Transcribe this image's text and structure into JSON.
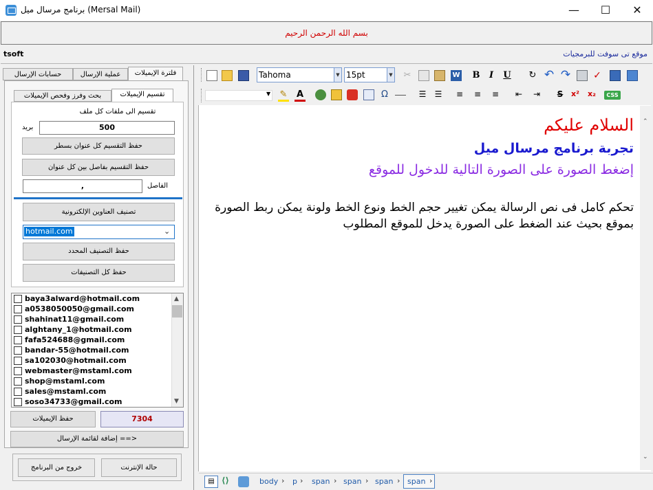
{
  "window": {
    "title": "برنامج مرسال ميل (Mersal Mail)",
    "minimize": "—",
    "maximize": "☐",
    "close": "✕"
  },
  "header": {
    "bismillah": "بسم الله الرحمن الرحيم",
    "brand": "tsoft",
    "site": "موقع تى سوفت للبرمجيات"
  },
  "tabs": [
    "فلترة الإيميلات",
    "عملية الإرسال",
    "حسابات الإرسال"
  ],
  "subtabs": [
    "تقسيم الإيميلات",
    "بحث وفرز وفحص الإيميلات"
  ],
  "split": {
    "caption": "تقسيم الى ملفات كل ملف",
    "count": "500",
    "count_unit": "بريد",
    "save_per_line": "حفظ التقسيم كل عنوان بسطر",
    "save_separator": "حفظ التقسيم بفاصل بين كل عنوان",
    "separator_value": ",",
    "separator_label": "الفاصل"
  },
  "classify": {
    "classify_button": "تصنيف العناوين الإلكترونية",
    "selected_domain": "hotmail.com",
    "save_selected": "حفظ التصنيف المحدد",
    "save_all": "حفظ كل التصنيفات"
  },
  "emails": [
    "baya3alward@hotmail.com",
    "a0538050050@gmail.com",
    "shahinat11@gmail.com",
    "alghtany_1@hotmail.com",
    "fafa524688@gmail.com",
    "bandar-55@hotmail.com",
    "sa102030@hotmail.com",
    "webmaster@mstaml.com",
    "shop@mstaml.com",
    "sales@mstaml.com",
    "soso34733@gmail.com"
  ],
  "list_footer": {
    "email_count": "7304",
    "save_emails": "حفظ الإيميلات",
    "add_to_send_list": "إضافة لقائمة الإرسال ==>"
  },
  "bottom_buttons": {
    "internet_status": "حالة الإنترنت",
    "exit": "خروج من البرنامج"
  },
  "toolbar": {
    "font": "Tahoma",
    "size": "15pt",
    "bold": "B",
    "italic": "I",
    "underline": "U",
    "strike": "S",
    "css_badge": "CSS",
    "omega": "Ω"
  },
  "editor": {
    "line1": "السلام عليكم",
    "line2": "تجربة برنامج مرسال ميل",
    "line3": "إضغط الصورة على الصورة التالية للدخول للموقع",
    "para": "تحكم كامل فى نص الرسالة يمكن تغيير حجم الخط ونوع الخط ولونة يمكن ربط الصورة بموقع بحيث عند الضغط على الصورة يدخل للموقع المطلوب"
  },
  "breadcrumb": [
    "body",
    "p",
    "span",
    "span",
    "span",
    "span"
  ],
  "colors": {
    "accent": "#1e73c8",
    "bismillah": "#d00000",
    "site_link": "#1a2a9c",
    "count": "#b00000",
    "line1": "#e00000",
    "line2": "#1a1acf",
    "line3": "#8a2be2"
  }
}
